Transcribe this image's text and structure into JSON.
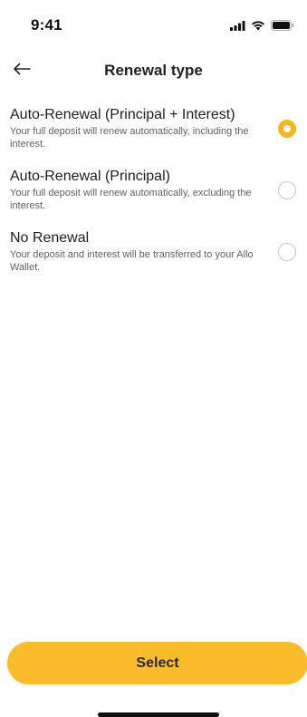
{
  "status_bar": {
    "time": "9:41"
  },
  "header": {
    "title": "Renewal type",
    "back_icon": "arrow-left-icon"
  },
  "options": [
    {
      "title": "Auto-Renewal (Principal + Interest)",
      "description": "Your full deposit will renew automatically, including the interest.",
      "selected": true
    },
    {
      "title": "Auto-Renewal (Principal)",
      "description": "Your full deposit will renew automatically, excluding the interest.",
      "selected": false
    },
    {
      "title": "No Renewal",
      "description": "Your deposit and interest will be transferred to your Allo Wallet.",
      "selected": false
    }
  ],
  "footer": {
    "select_label": "Select"
  },
  "colors": {
    "accent": "#fbbc2b",
    "radio_selected": "#f5b71d"
  }
}
